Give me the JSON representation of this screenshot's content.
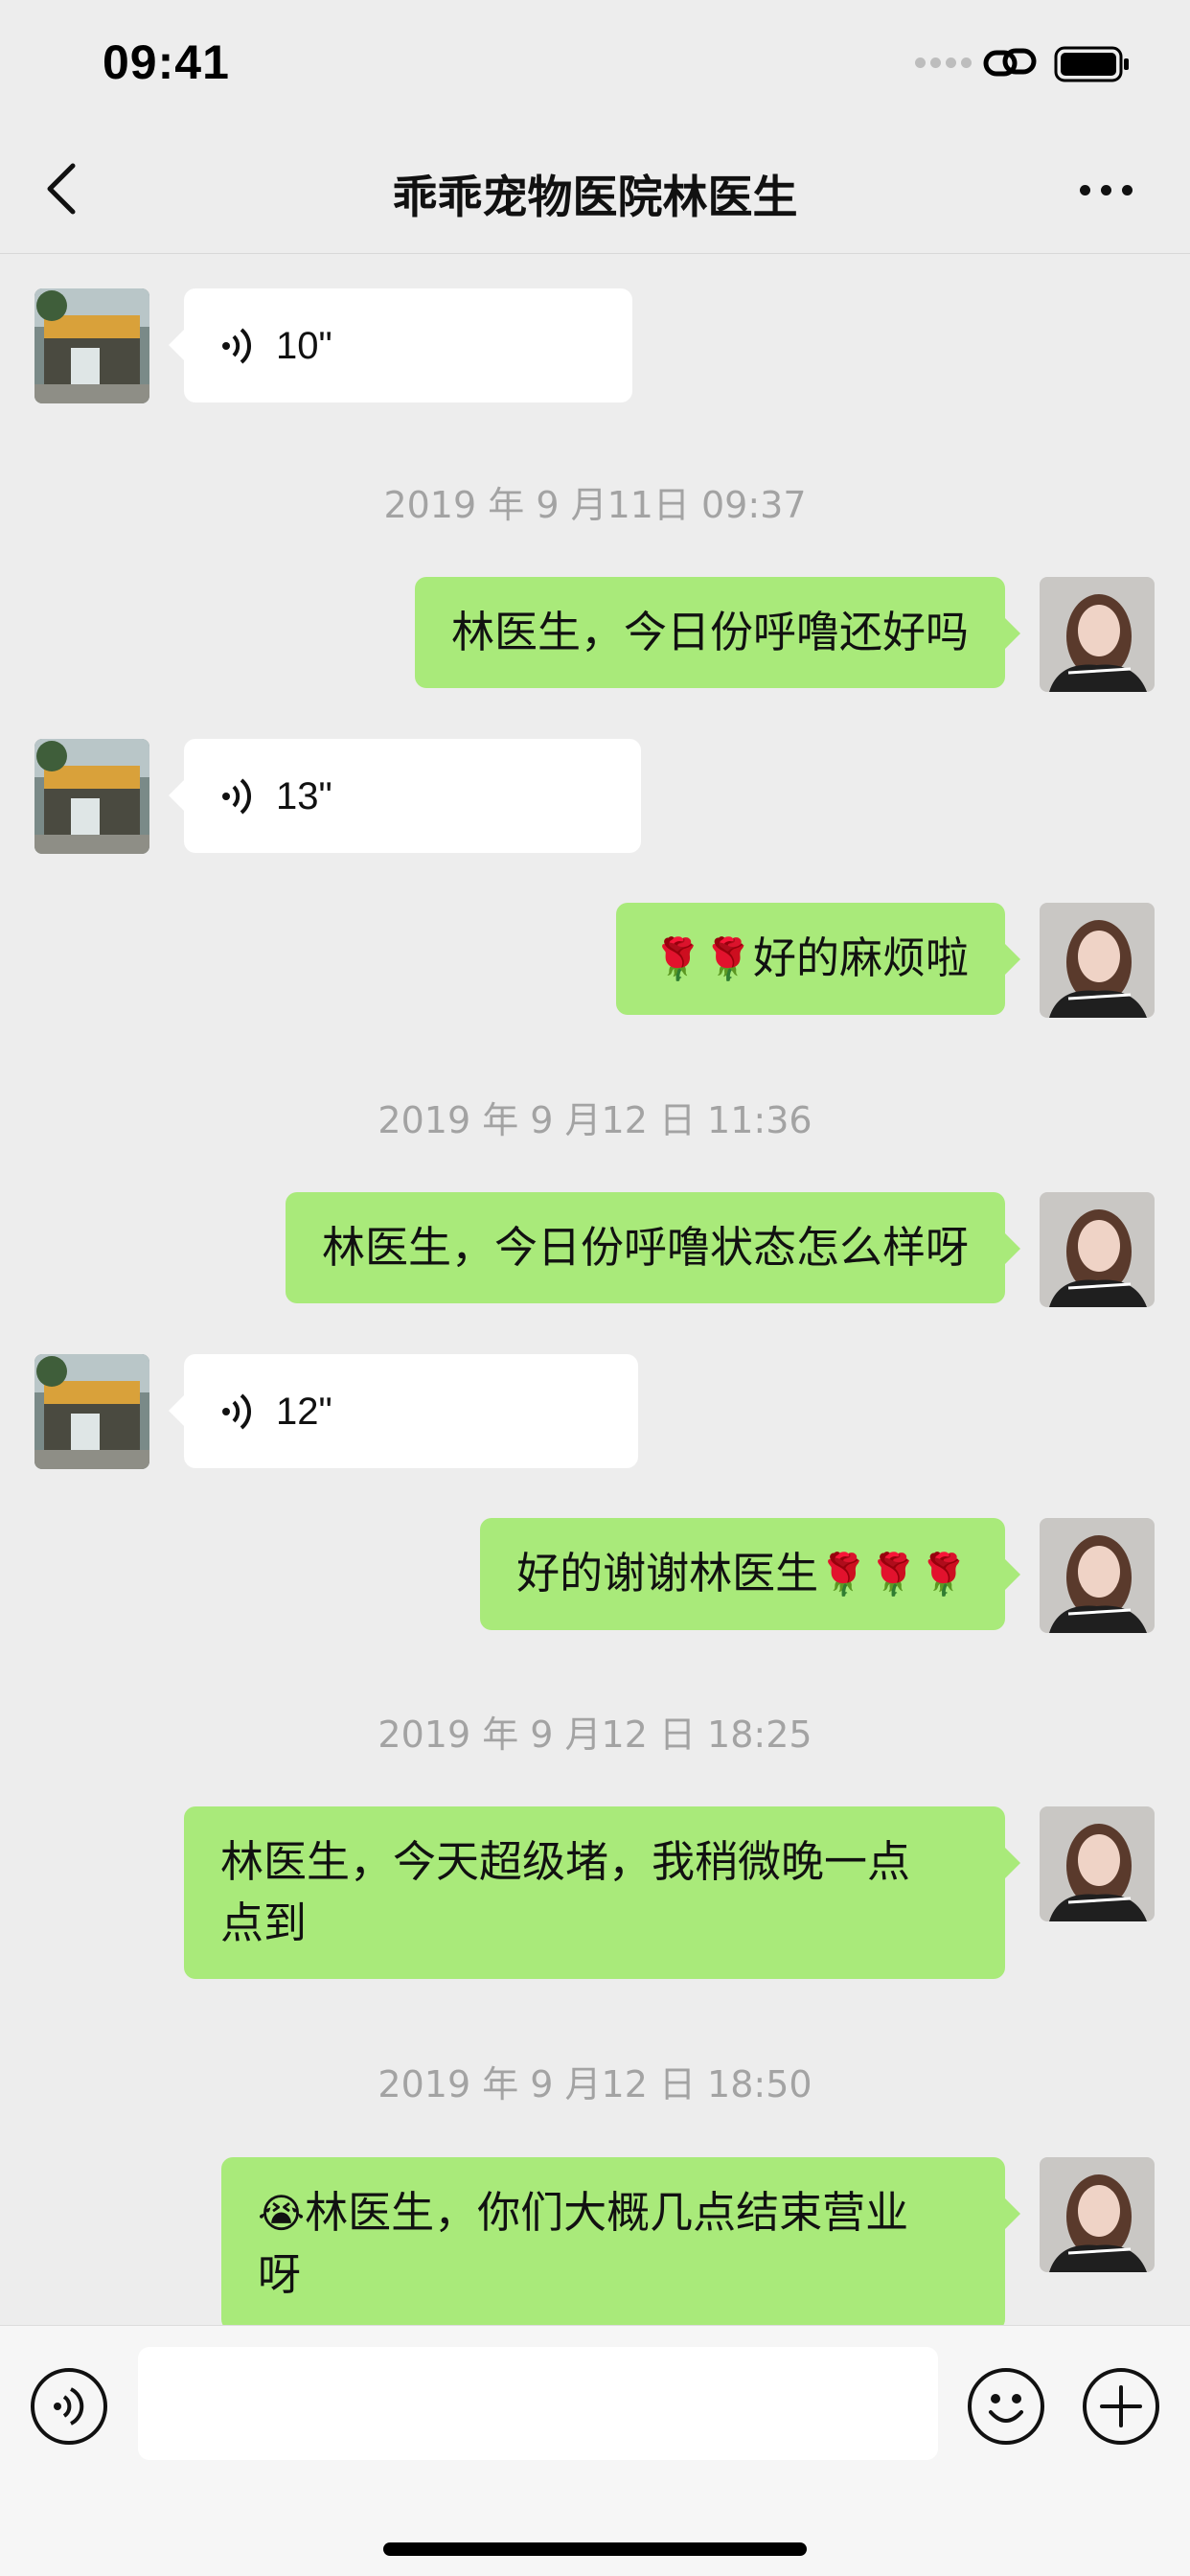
{
  "status_bar": {
    "time": "09:41"
  },
  "header": {
    "title": "乖乖宠物医院林医生"
  },
  "colors": {
    "background": "#ededed",
    "outgoing_bubble": "#a9ea7a",
    "incoming_bubble": "#ffffff",
    "timestamp": "#a3a3a3"
  },
  "messages": [
    {
      "type": "voice",
      "direction": "incoming",
      "duration": "10\""
    },
    {
      "type": "timestamp",
      "text": "2019 年 9 月11日 09:37"
    },
    {
      "type": "text",
      "direction": "outgoing",
      "text": "林医生，今日份呼噜还好吗"
    },
    {
      "type": "voice",
      "direction": "incoming",
      "duration": "13\""
    },
    {
      "type": "text",
      "direction": "outgoing",
      "emoji": "🌹🌹",
      "text": "好的麻烦啦"
    },
    {
      "type": "timestamp",
      "text": "2019 年 9 月12 日 11:36"
    },
    {
      "type": "text",
      "direction": "outgoing",
      "text": "林医生，今日份呼噜状态怎么样呀"
    },
    {
      "type": "voice",
      "direction": "incoming",
      "duration": "12\""
    },
    {
      "type": "text",
      "direction": "outgoing",
      "text": "好的谢谢林医生",
      "emoji": "🌹🌹🌹"
    },
    {
      "type": "timestamp",
      "text": "2019 年 9 月12 日 18:25"
    },
    {
      "type": "text",
      "direction": "outgoing",
      "line1": "林医生，今天超级堵，我稍微晚一点",
      "line2": "点到"
    },
    {
      "type": "timestamp",
      "text": "2019 年 9 月12 日 18:50"
    },
    {
      "type": "text",
      "direction": "outgoing",
      "emoji": "😭",
      "line1": "林医生，你们大概几点结束营业",
      "line2": "呀"
    }
  ],
  "input_bar": {
    "voice_icon": "voice-toggle-icon",
    "emoji_icon": "smiley-icon",
    "plus_icon": "plus-icon",
    "text_value": ""
  }
}
